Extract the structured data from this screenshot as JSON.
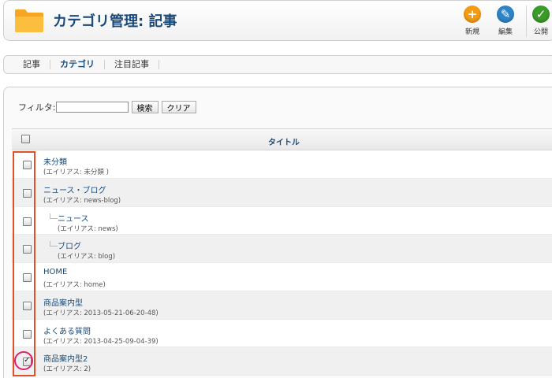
{
  "header": {
    "title": "カテゴリ管理: 記事",
    "folder_icon": "folder-icon",
    "toolbar": [
      {
        "id": "new",
        "label": "新規",
        "icon": "plus-icon",
        "symbol": "+",
        "color": "#f39c12"
      },
      {
        "id": "edit",
        "label": "編集",
        "icon": "pencil-icon",
        "symbol": "✎",
        "color": "#2f84c6"
      },
      {
        "id": "publish",
        "label": "公開",
        "icon": "check-icon",
        "symbol": "✓",
        "color": "#3a9a2a"
      }
    ]
  },
  "submenu": {
    "items": [
      {
        "label": "記事",
        "active": false
      },
      {
        "label": "カテゴリ",
        "active": true
      },
      {
        "label": "注目記事",
        "active": false
      }
    ]
  },
  "filter": {
    "label": "フィルタ:",
    "value": "",
    "search_label": "検索",
    "clear_label": "クリア"
  },
  "table": {
    "column_title": "タイトル",
    "rows": [
      {
        "name": "未分類",
        "alias": "(エイリアス: 未分類 )",
        "level": 0,
        "checked": false
      },
      {
        "name": "ニュース・ブログ",
        "alias": "(エイリアス: news-blog)",
        "level": 0,
        "checked": false
      },
      {
        "name": "ニュース",
        "alias": "(エイリアス: news)",
        "level": 1,
        "checked": false
      },
      {
        "name": "ブログ",
        "alias": "(エイリアス: blog)",
        "level": 1,
        "checked": false
      },
      {
        "name": "HOME",
        "alias": "(エイリアス: home)",
        "level": 0,
        "checked": false
      },
      {
        "name": "商品案内型",
        "alias": "(エイリアス: 2013-05-21-06-20-48)",
        "level": 0,
        "checked": false
      },
      {
        "name": "よくある質問",
        "alias": "(エイリアス: 2013-04-25-09-04-39)",
        "level": 0,
        "checked": false
      },
      {
        "name": "商品案内型2",
        "alias": "(エイリアス: 2)",
        "level": 0,
        "checked": true
      }
    ]
  },
  "colors": {
    "title_blue": "#1a4a7a",
    "highlight_box": "#e0502a",
    "highlight_circle": "#e0206a"
  }
}
